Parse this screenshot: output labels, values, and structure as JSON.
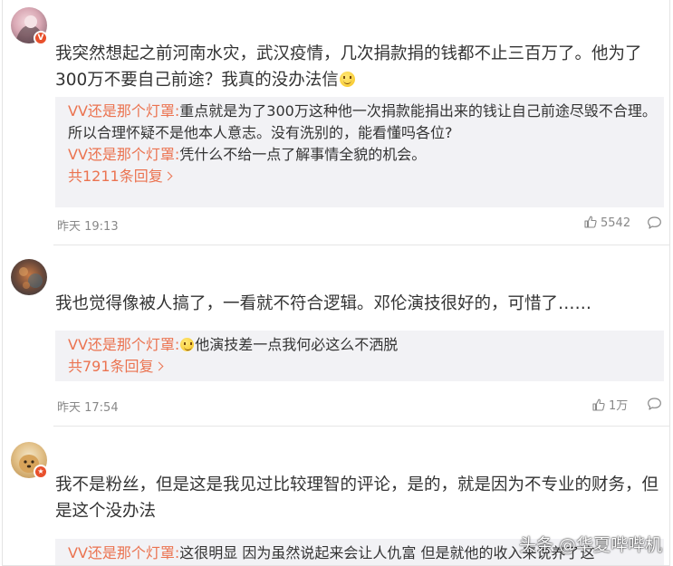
{
  "comments": [
    {
      "text": "我突然想起之前河南水灾，武汉疫情，几次捐款捐的钱都不止三百万了。他为了300万不要自己前途？我真的没办法信",
      "emoji": "smile",
      "badge": "V",
      "replies": [
        {
          "user": "VV还是那个灯罩:",
          "text": "重点就是为了300万这种他一次捐款能捐出来的钱让自己前途尽毁不合理。所以合理怀疑不是他本人意志。没有洗别的，能看懂吗各位?"
        },
        {
          "user": "VV还是那个灯罩:",
          "text": "凭什么不给一点了解事情全貌的机会。"
        }
      ],
      "more": "共1211条回复",
      "time": "昨天 19:13",
      "likes": "5542"
    },
    {
      "text": "我也觉得像被人搞了，一看就不符合逻辑。邓伦演技很好的，可惜了……",
      "replies": [
        {
          "user": "VV还是那个灯罩:",
          "emoji": "smile",
          "text": "他演技差一点我何必这么不洒脱"
        }
      ],
      "more": "共791条回复",
      "time": "昨天 17:54",
      "likes": "1万"
    },
    {
      "text": "我不是粉丝，但是这是我见过比较理智的评论，是的，就是因为不专业的财务，但是这个没办法",
      "badge": "★",
      "replies": [
        {
          "user": "VV还是那个灯罩:",
          "text": "这很明显 因为虽然说起来会让人仇富 但是就他的收入来说养了这"
        }
      ]
    }
  ],
  "watermark": "头条 @华夏哔哔机",
  "colors": {
    "username": "#eb7350",
    "reply_bg": "#f2f2f5",
    "vip_badge": "#e8502c"
  }
}
